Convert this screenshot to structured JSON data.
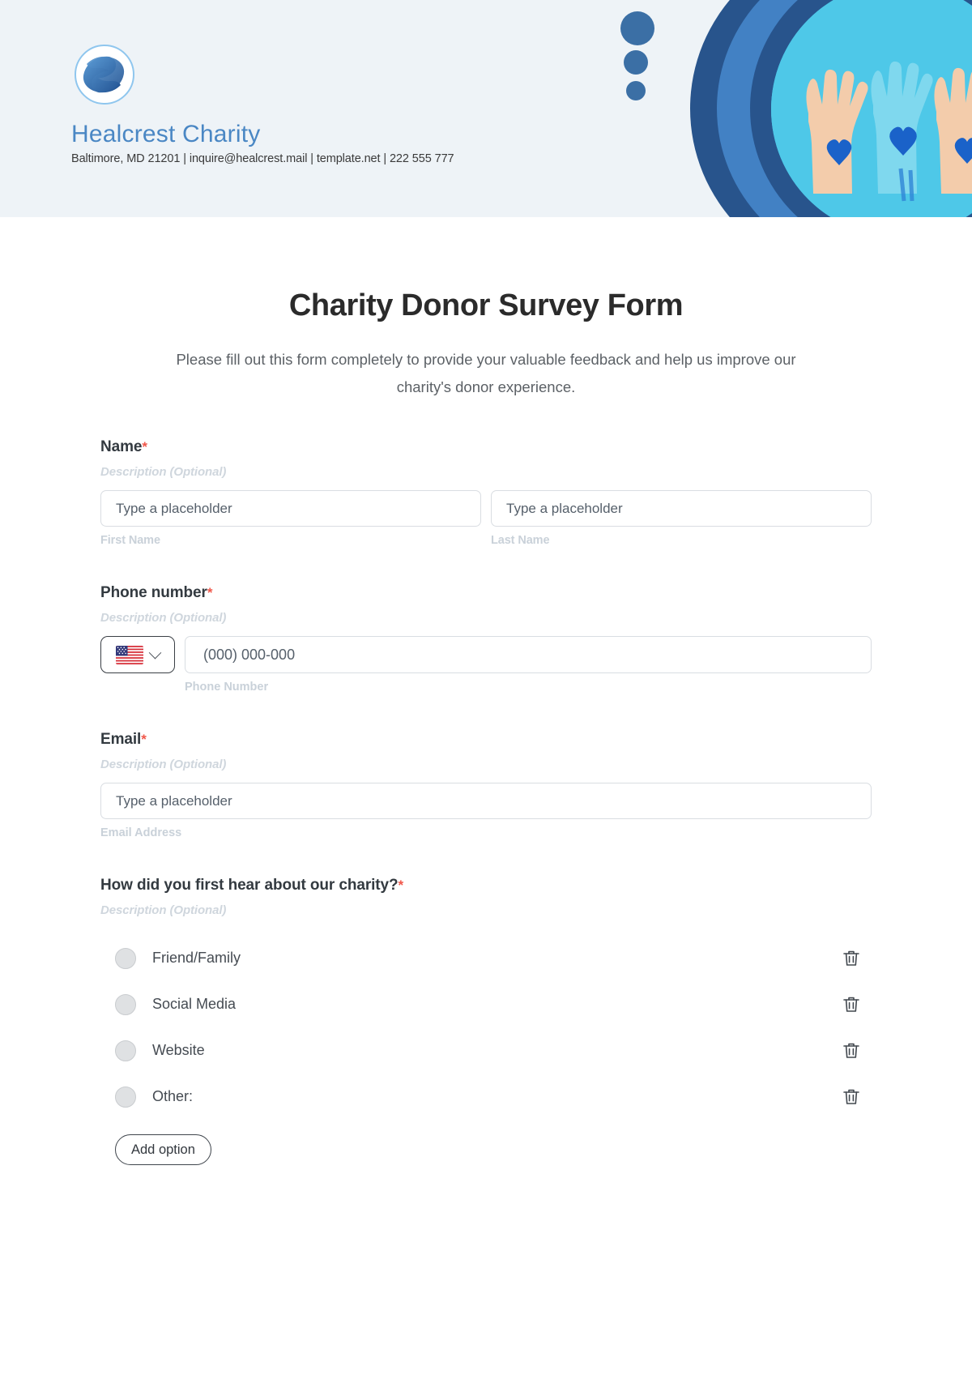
{
  "header": {
    "brand_name": "Healcrest Charity",
    "contact_line": "Baltimore, MD 21201 | inquire@healcrest.mail | template.net | 222 555 777",
    "logo_icon": "helping-hands-logo",
    "hero_icon": "raised-hands-photo",
    "colors": {
      "band_bg": "#eef3f7",
      "brand_blue": "#4a87c4",
      "ring_dark": "#28548c",
      "ring_light": "#4281c4",
      "photo_bg": "#4ec8e8"
    }
  },
  "form": {
    "title": "Charity Donor Survey Form",
    "subtitle": "Please fill out this form completely to provide your valuable feedback and help us improve our charity's donor experience.",
    "required_marker": "*",
    "description_placeholder": "Description (Optional)",
    "fields": {
      "name": {
        "label": "Name",
        "description": "Description (Optional)",
        "first_placeholder": "Type a placeholder",
        "last_placeholder": "Type a placeholder",
        "first_sublabel": "First Name",
        "last_sublabel": "Last Name"
      },
      "phone": {
        "label": "Phone number",
        "description": "Description (Optional)",
        "country_flag": "us-flag-icon",
        "dropdown_icon": "chevron-down-icon",
        "placeholder": "(000) 000-000",
        "sublabel": "Phone Number"
      },
      "email": {
        "label": "Email",
        "description": "Description (Optional)",
        "placeholder": "Type a placeholder",
        "sublabel": "Email Address"
      },
      "hear_about": {
        "label": "How did you first hear about our charity?",
        "description": "Description (Optional)",
        "options": [
          {
            "label": "Friend/Family",
            "delete_icon": "trash-icon"
          },
          {
            "label": "Social Media",
            "delete_icon": "trash-icon"
          },
          {
            "label": "Website",
            "delete_icon": "trash-icon"
          },
          {
            "label": "Other:",
            "delete_icon": "trash-icon"
          }
        ],
        "add_option_label": "Add option"
      }
    }
  }
}
